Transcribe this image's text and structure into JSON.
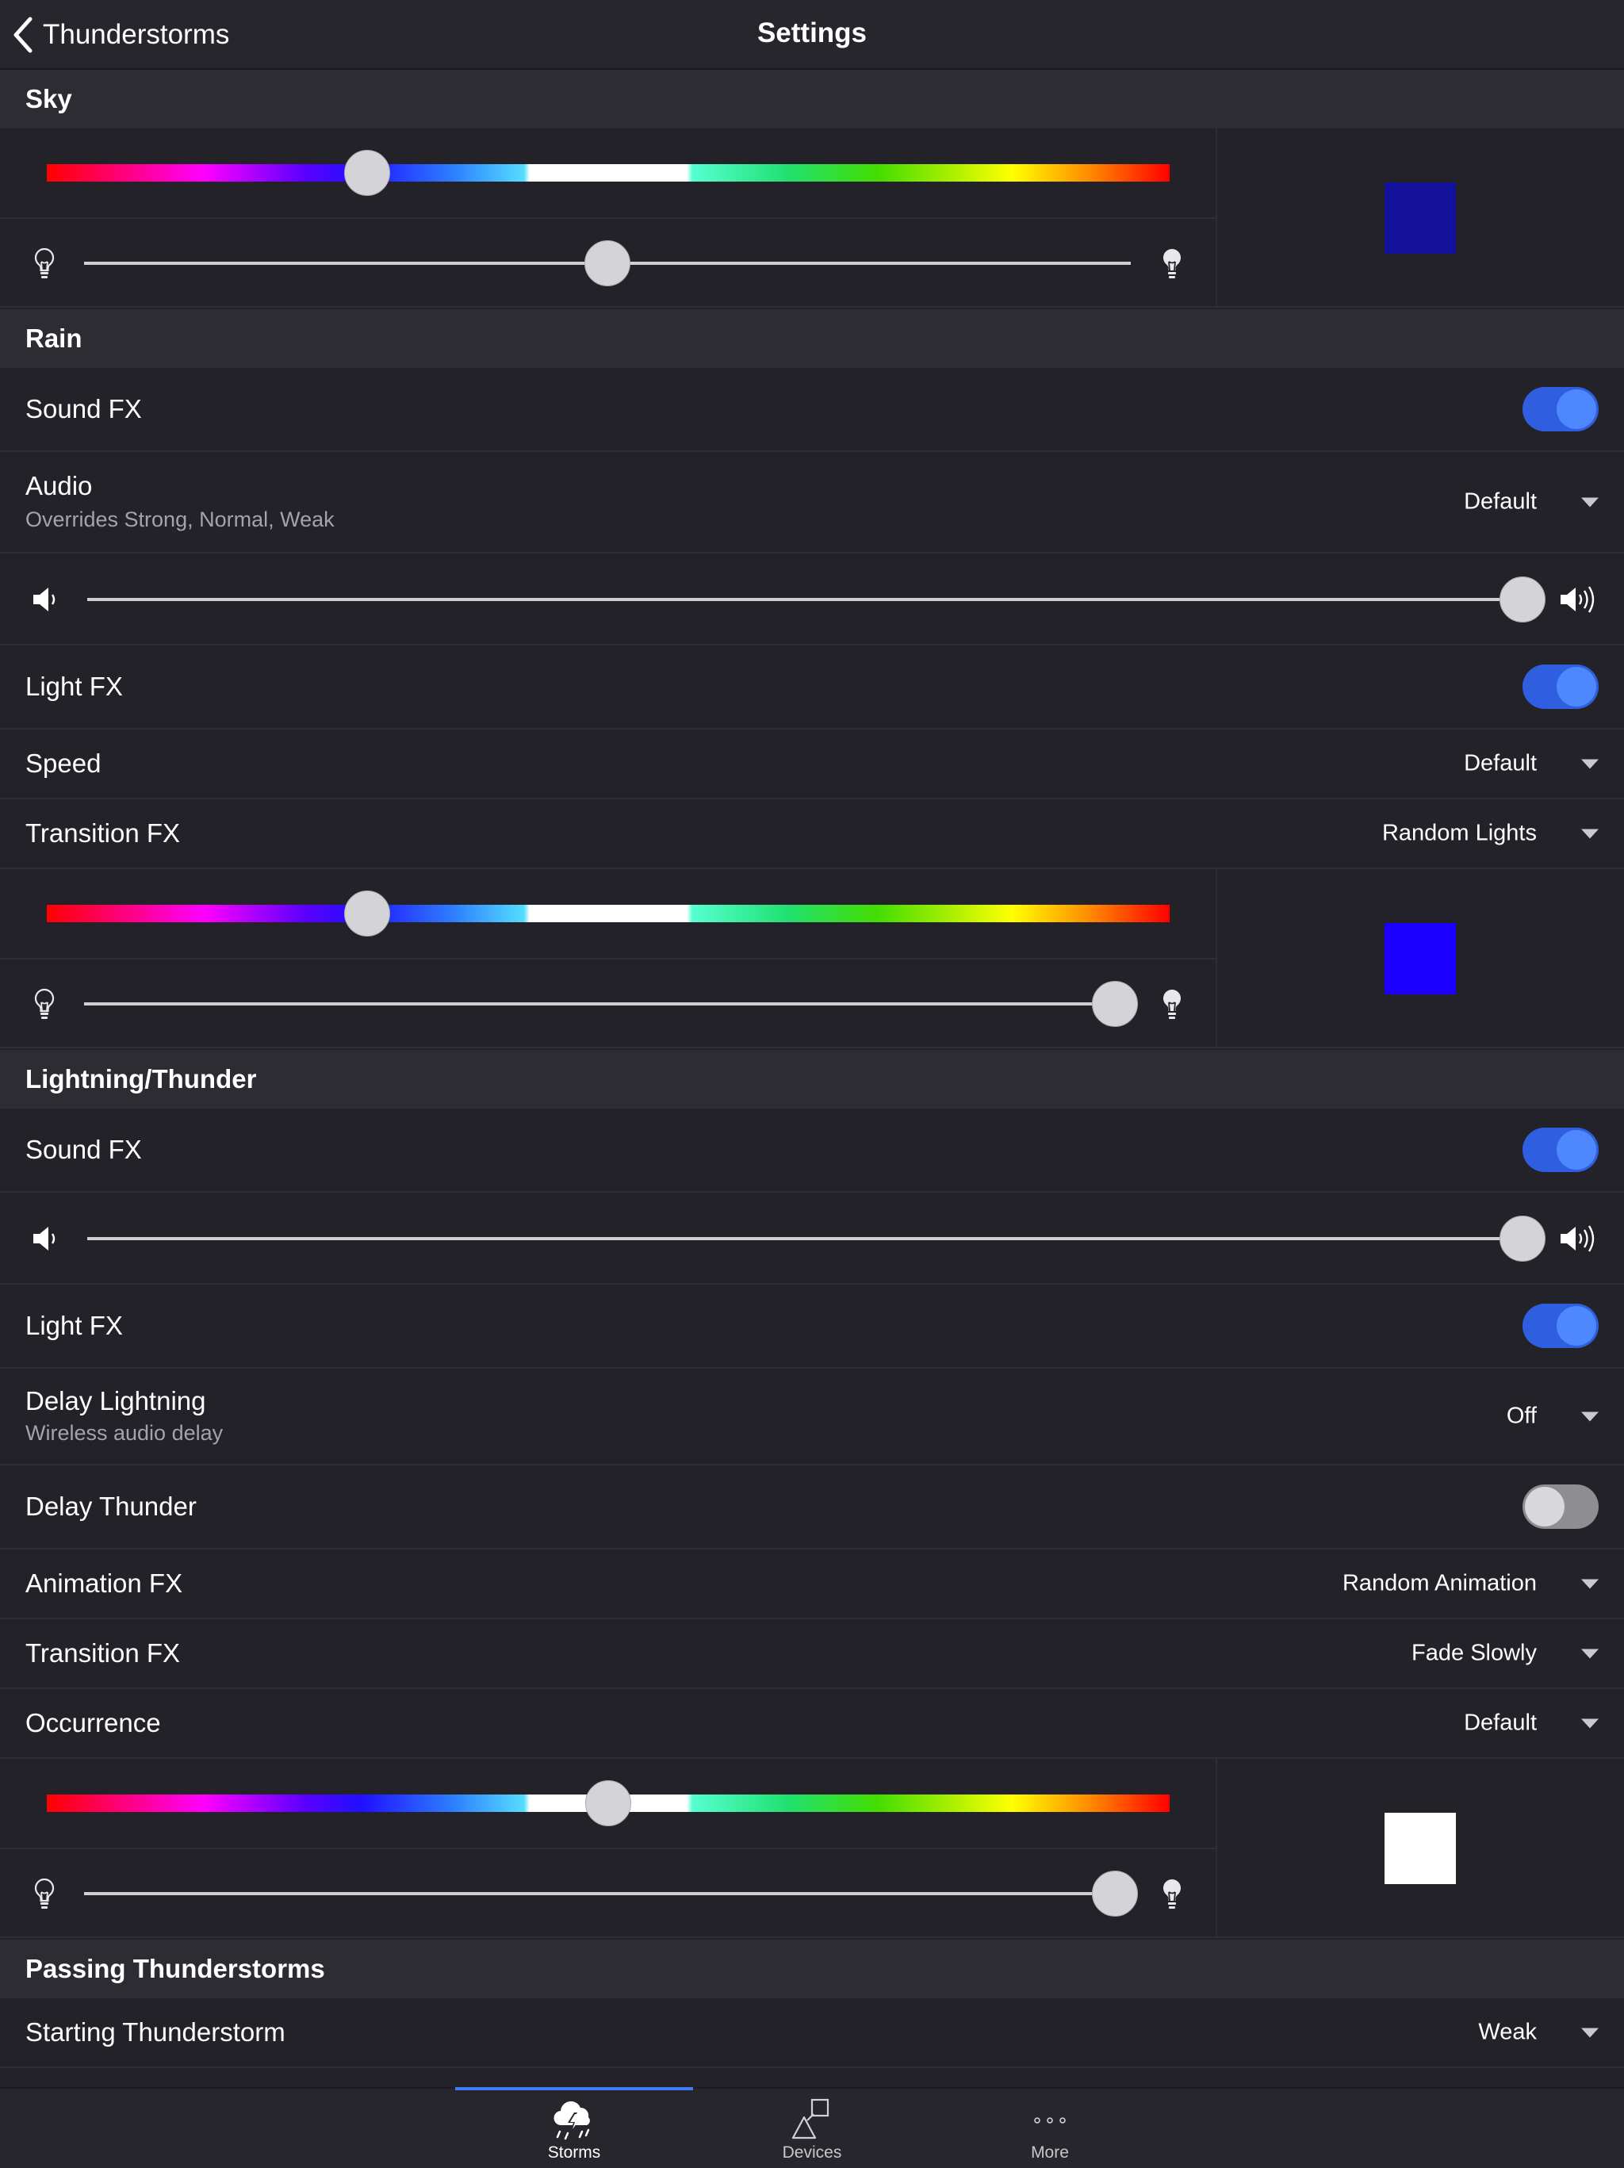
{
  "nav": {
    "back_label": "Thunderstorms",
    "title": "Settings"
  },
  "sky": {
    "header": "Sky",
    "hue_position": 0.285,
    "brightness_position": 0.5,
    "swatch_color": "#13109a"
  },
  "rain": {
    "header": "Rain",
    "sound_fx": {
      "label": "Sound FX",
      "on": true
    },
    "audio": {
      "label": "Audio",
      "sublabel": "Overrides Strong, Normal, Weak",
      "value": "Default"
    },
    "volume_position": 1.0,
    "light_fx": {
      "label": "Light FX",
      "on": true
    },
    "speed": {
      "label": "Speed",
      "value": "Default"
    },
    "transition_fx": {
      "label": "Transition FX",
      "value": "Random Lights"
    },
    "hue_position": 0.285,
    "brightness_position": 0.985,
    "swatch_color": "#1c00ff"
  },
  "lightning": {
    "header": "Lightning/Thunder",
    "sound_fx": {
      "label": "Sound FX",
      "on": true
    },
    "volume_position": 1.0,
    "light_fx": {
      "label": "Light FX",
      "on": true
    },
    "delay_lightning": {
      "label": "Delay Lightning",
      "sublabel": "Wireless audio delay",
      "value": "Off"
    },
    "delay_thunder": {
      "label": "Delay Thunder",
      "on": false
    },
    "animation_fx": {
      "label": "Animation FX",
      "value": "Random Animation"
    },
    "transition_fx": {
      "label": "Transition FX",
      "value": "Fade Slowly"
    },
    "occurrence": {
      "label": "Occurrence",
      "value": "Default"
    },
    "hue_position": 0.5,
    "brightness_position": 0.985,
    "swatch_color": "#ffffff"
  },
  "passing": {
    "header": "Passing Thunderstorms",
    "starting": {
      "label": "Starting Thunderstorm",
      "value": "Weak"
    }
  },
  "tabs": [
    {
      "label": "Storms",
      "icon": "storm-cloud-icon",
      "active": true
    },
    {
      "label": "Devices",
      "icon": "shapes-icon",
      "active": false
    },
    {
      "label": "More",
      "icon": "more-dots-icon",
      "active": false
    }
  ],
  "colors": {
    "accent": "#3f7cf5",
    "toggle_on": "#2f5ee0",
    "background": "#232329"
  }
}
